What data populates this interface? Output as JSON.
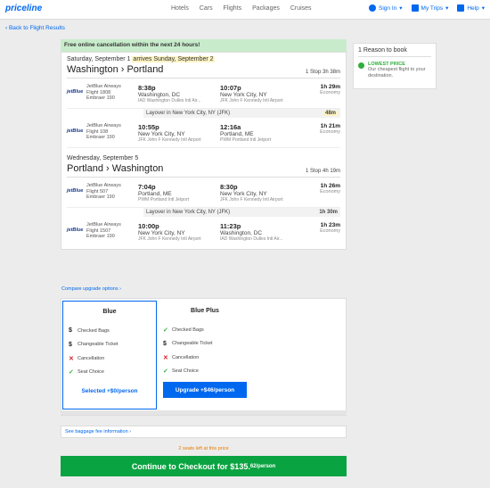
{
  "nav": {
    "logo": "priceline",
    "links": [
      "Hotels",
      "Cars",
      "Flights",
      "Packages",
      "Cruises"
    ],
    "sign_in": "Sign In",
    "my_trips": "My Trips",
    "help": "Help"
  },
  "back_link": "‹ Back to Flight Results",
  "cancel_notice": "Free online cancellation within the next 24 hours!",
  "outbound": {
    "date": "Saturday, September 1",
    "arrives": "arrives Sunday, September 2",
    "route": "Washington › Portland",
    "stops": "1 Stop  3h 38m",
    "flights": [
      {
        "airline": "JetBlue Airways",
        "flight": "Flight 1808",
        "aircraft": "Embraer 190",
        "dep_time": "8:38p",
        "dep_city": "Washington, DC",
        "dep_airport": "IAD Washington Dulles Intl Air...",
        "arr_time": "10:07p",
        "arr_city": "New York City, NY",
        "arr_airport": "JFK John F Kennedy Intl Airport",
        "duration": "1h 29m",
        "cabin": "Economy"
      },
      {
        "airline": "JetBlue Airways",
        "flight": "Flight 108",
        "aircraft": "Embraer 190",
        "dep_time": "10:55p",
        "dep_city": "New York City, NY",
        "dep_airport": "JFK John F Kennedy Intl Airport",
        "arr_time": "12:16a",
        "arr_city": "Portland, ME",
        "arr_airport": "PWM Portland Intl Jetport",
        "duration": "1h 21m",
        "cabin": "Economy"
      }
    ],
    "layover": "Layover in New York City, NY (JFK)",
    "layover_time": "48m"
  },
  "return": {
    "date": "Wednesday, September 5",
    "route": "Portland › Washington",
    "stops": "1 Stop  4h 19m",
    "flights": [
      {
        "airline": "JetBlue Airways",
        "flight": "Flight 507",
        "aircraft": "Embraer 190",
        "dep_time": "7:04p",
        "dep_city": "Portland, ME",
        "dep_airport": "PWM Portland Intl Jetport",
        "arr_time": "8:30p",
        "arr_city": "New York City, NY",
        "arr_airport": "JFK John F Kennedy Intl Airport",
        "duration": "1h 26m",
        "cabin": "Economy"
      },
      {
        "airline": "JetBlue Airways",
        "flight": "Flight 1507",
        "aircraft": "Embraer 190",
        "dep_time": "10:00p",
        "dep_city": "New York City, NY",
        "dep_airport": "JFK John F Kennedy Intl Airport",
        "arr_time": "11:23p",
        "arr_city": "Washington, DC",
        "arr_airport": "IAD Washington Dulles Intl Air...",
        "duration": "1h 23m",
        "cabin": "Economy"
      }
    ],
    "layover": "Layover in New York City, NY (JFK)",
    "layover_time": "1h 30m"
  },
  "compare_link": "Compare upgrade options",
  "plans": [
    {
      "name": "Blue",
      "features": [
        "Checked Bags",
        "Changeable Ticket",
        "Cancellation",
        "Seat Choice"
      ],
      "button": "Selected +$0/person"
    },
    {
      "name": "Blue Plus",
      "features": [
        "Checked Bags",
        "Changeable Ticket",
        "Cancellation",
        "Seat Choice"
      ],
      "button": "Upgrade +$46/person"
    }
  ],
  "baggage_link": "See baggage fee information",
  "seats_left": "2 seats left at this price",
  "checkout": {
    "label": "Continue to Checkout for $135.",
    "cents": "62/person"
  },
  "reason": {
    "title": "1 Reason to book",
    "head": "LOWEST PRICE",
    "desc": "Our cheapest flight to your destination."
  },
  "colors": {
    "brand_blue": "#0068ef",
    "checkout_green": "#0aa341",
    "notice_green": "#c8eccb"
  }
}
